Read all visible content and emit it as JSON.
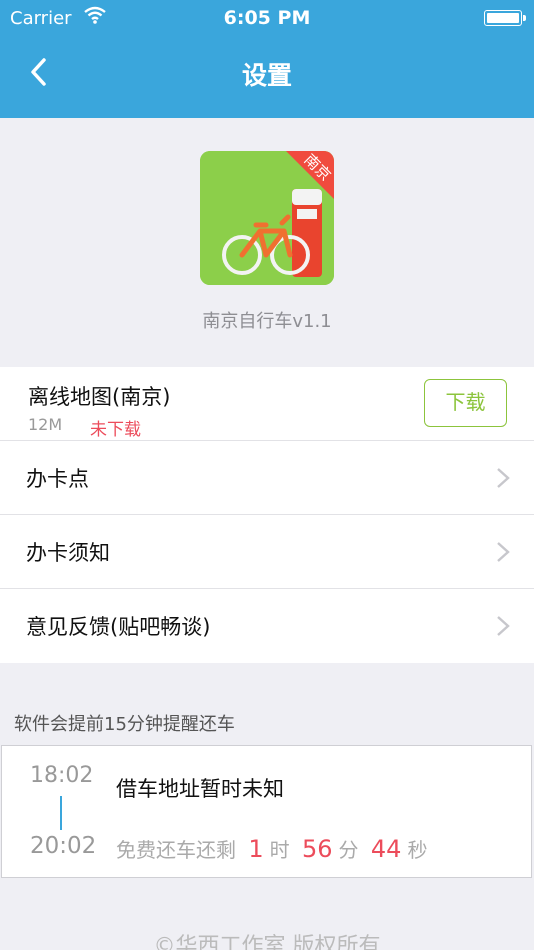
{
  "status_bar": {
    "carrier": "Carrier",
    "time": "6:05 PM"
  },
  "nav": {
    "title": "设置",
    "back_icon": "chevron-left-icon"
  },
  "app": {
    "name": "南京自行车v1.1",
    "badge": "南京",
    "icon_bg": "#8ccf4a"
  },
  "offline_map": {
    "label": "离线地图(南京)",
    "size": "12M",
    "status": "未下载",
    "button": "下载"
  },
  "menu": [
    {
      "label": "办卡点"
    },
    {
      "label": "办卡须知"
    },
    {
      "label": "意见反馈(贴吧畅谈)"
    }
  ],
  "reminder_hint": "软件会提前15分钟提醒还车",
  "rental": {
    "start_time": "18:02",
    "end_time": "20:02",
    "address": "借车地址暂时未知",
    "remain_label": "免费还车还剩",
    "hours": "1",
    "hours_unit": "时",
    "minutes": "56",
    "minutes_unit": "分",
    "seconds": "44",
    "seconds_unit": "秒"
  },
  "footer": "©华西工作室 版权所有",
  "colors": {
    "nav": "#3aa6dc",
    "accent_green": "#8cc43c",
    "accent_red": "#ec4c5b"
  }
}
